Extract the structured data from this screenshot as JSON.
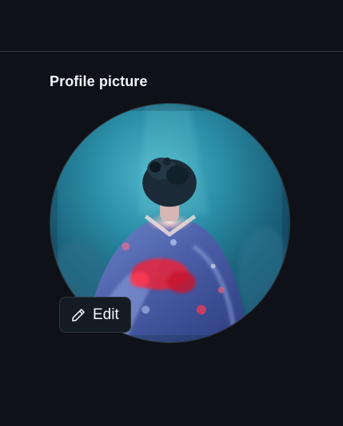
{
  "profile": {
    "section_title": "Profile picture",
    "edit_label": "Edit",
    "edit_icon": "pencil-icon",
    "avatar_alt": "Profile picture"
  },
  "colors": {
    "background": "#0e1117",
    "divider": "#30363d",
    "text": "#f0f6fc",
    "button_bg": "#151b23",
    "button_border": "#30363d"
  }
}
